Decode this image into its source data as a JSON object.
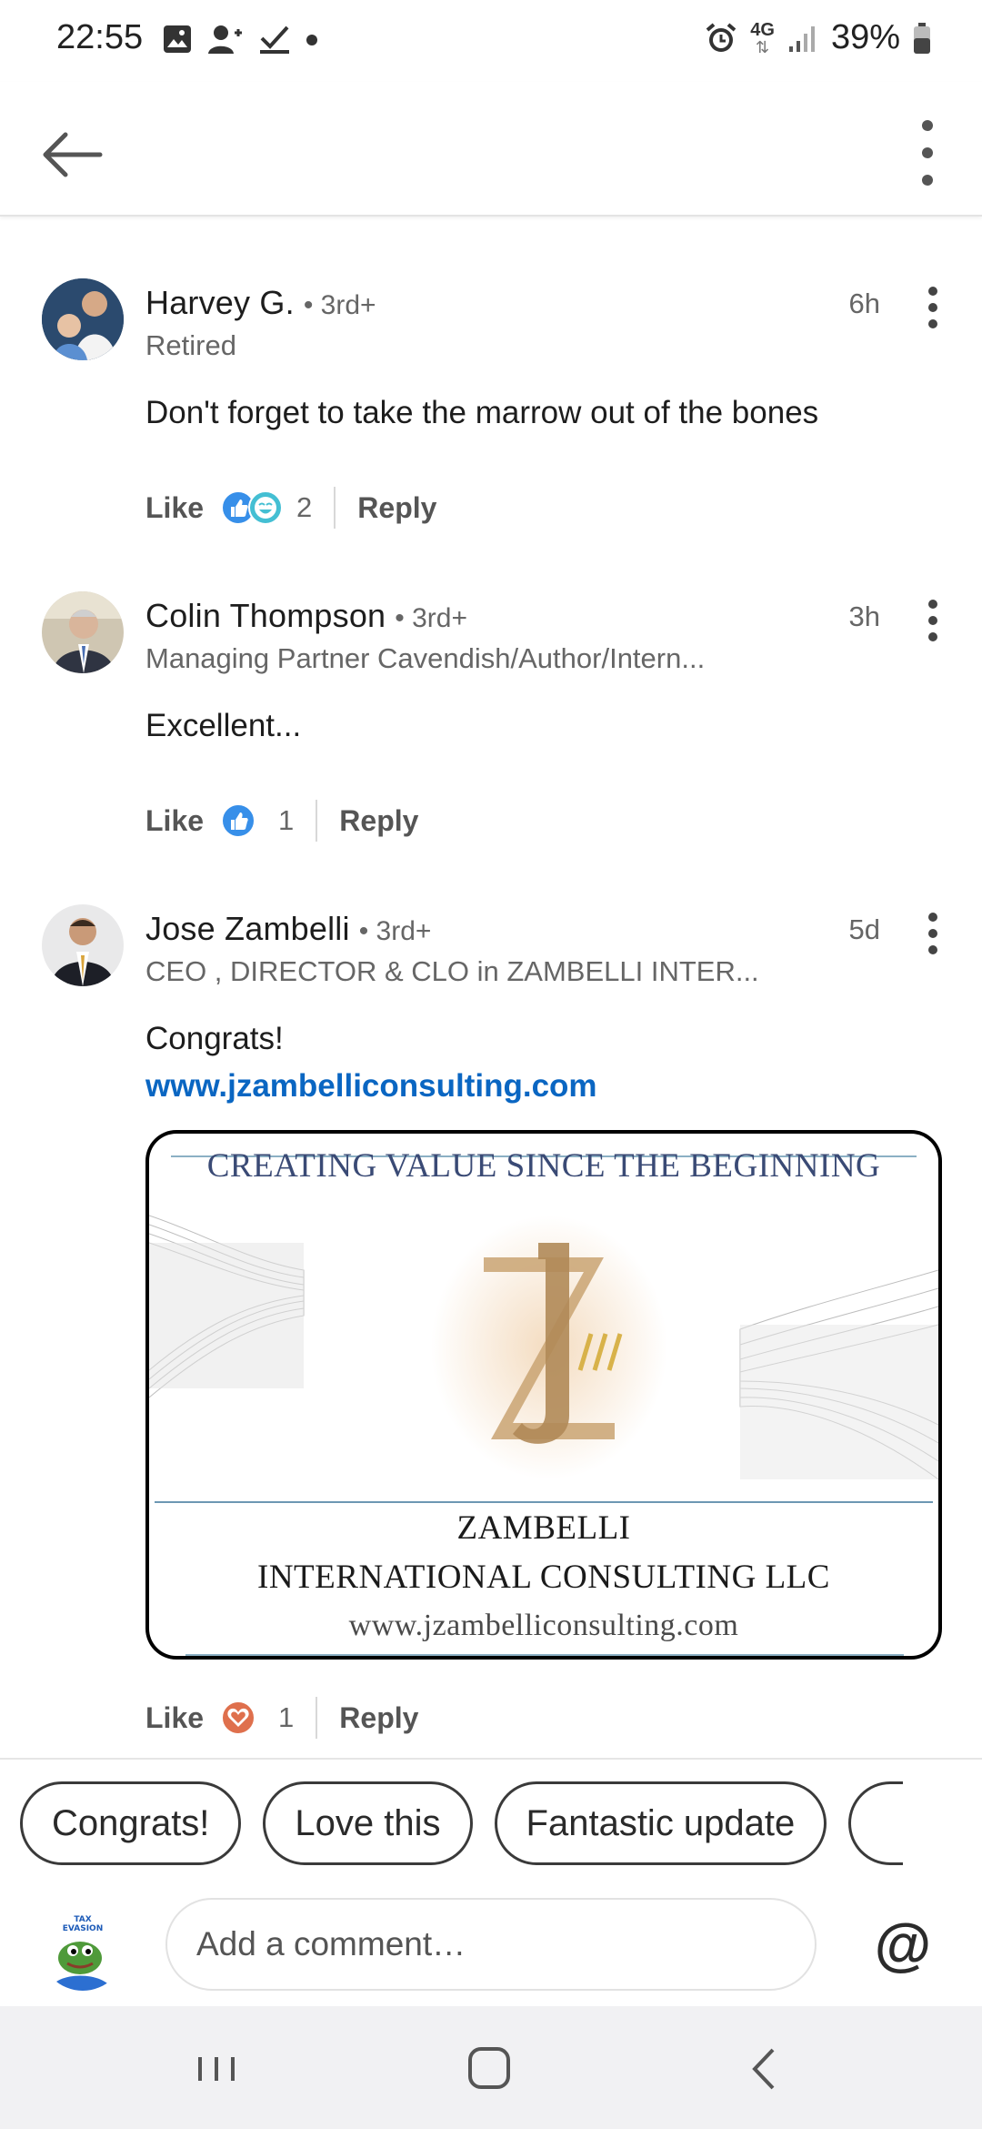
{
  "status_bar": {
    "time": "22:55",
    "network": "4G",
    "battery": "39%",
    "left_icons": [
      "image-icon",
      "person-add-icon",
      "check-icon",
      "dot-icon"
    ],
    "right_icons": [
      "alarm-icon",
      "network-4g-icon",
      "signal-icon",
      "battery-icon"
    ]
  },
  "header": {
    "back_icon": "arrow-left-icon",
    "more_icon": "more-vertical-icon"
  },
  "comments": [
    {
      "name": "Harvey G.",
      "degree": "• 3rd+",
      "headline": "Retired",
      "time": "6h",
      "text": "Don't forget to take the marrow out of the bones",
      "like_label": "Like",
      "reactions": [
        "like-reaction-icon",
        "funny-reaction-icon"
      ],
      "reaction_count": "2",
      "reply_label": "Reply"
    },
    {
      "name": "Colin Thompson",
      "degree": "• 3rd+",
      "headline": "Managing Partner Cavendish/Author/Intern...",
      "time": "3h",
      "text": "Excellent...",
      "like_label": "Like",
      "reactions": [
        "like-reaction-icon"
      ],
      "reaction_count": "1",
      "reply_label": "Reply"
    },
    {
      "name": "Jose Zambelli",
      "degree": "• 3rd+",
      "headline": "CEO , DIRECTOR & CLO in ZAMBELLI INTER...",
      "time": "5d",
      "text": "Congrats!",
      "link": "www.jzambelliconsulting.com",
      "image": {
        "headline": "CREATING VALUE SINCE THE BEGINNING",
        "company_line1": "ZAMBELLI",
        "company_line2": "INTERNATIONAL CONSULTING LLC",
        "url": "www.jzambelliconsulting.com",
        "logo_text": "JZ"
      },
      "like_label": "Like",
      "reactions": [
        "love-reaction-icon"
      ],
      "reaction_count": "1",
      "reply_label": "Reply"
    }
  ],
  "quick_replies": [
    "Congrats!",
    "Love this",
    "Fantastic update"
  ],
  "composer": {
    "placeholder": "Add a comment…",
    "mention": "@",
    "avatar_text": "TAX EVASION"
  },
  "colors": {
    "link": "#0a66c2",
    "like_blue": "#378fe9",
    "love_red": "#df704d",
    "funny_teal": "#44bfd3"
  }
}
